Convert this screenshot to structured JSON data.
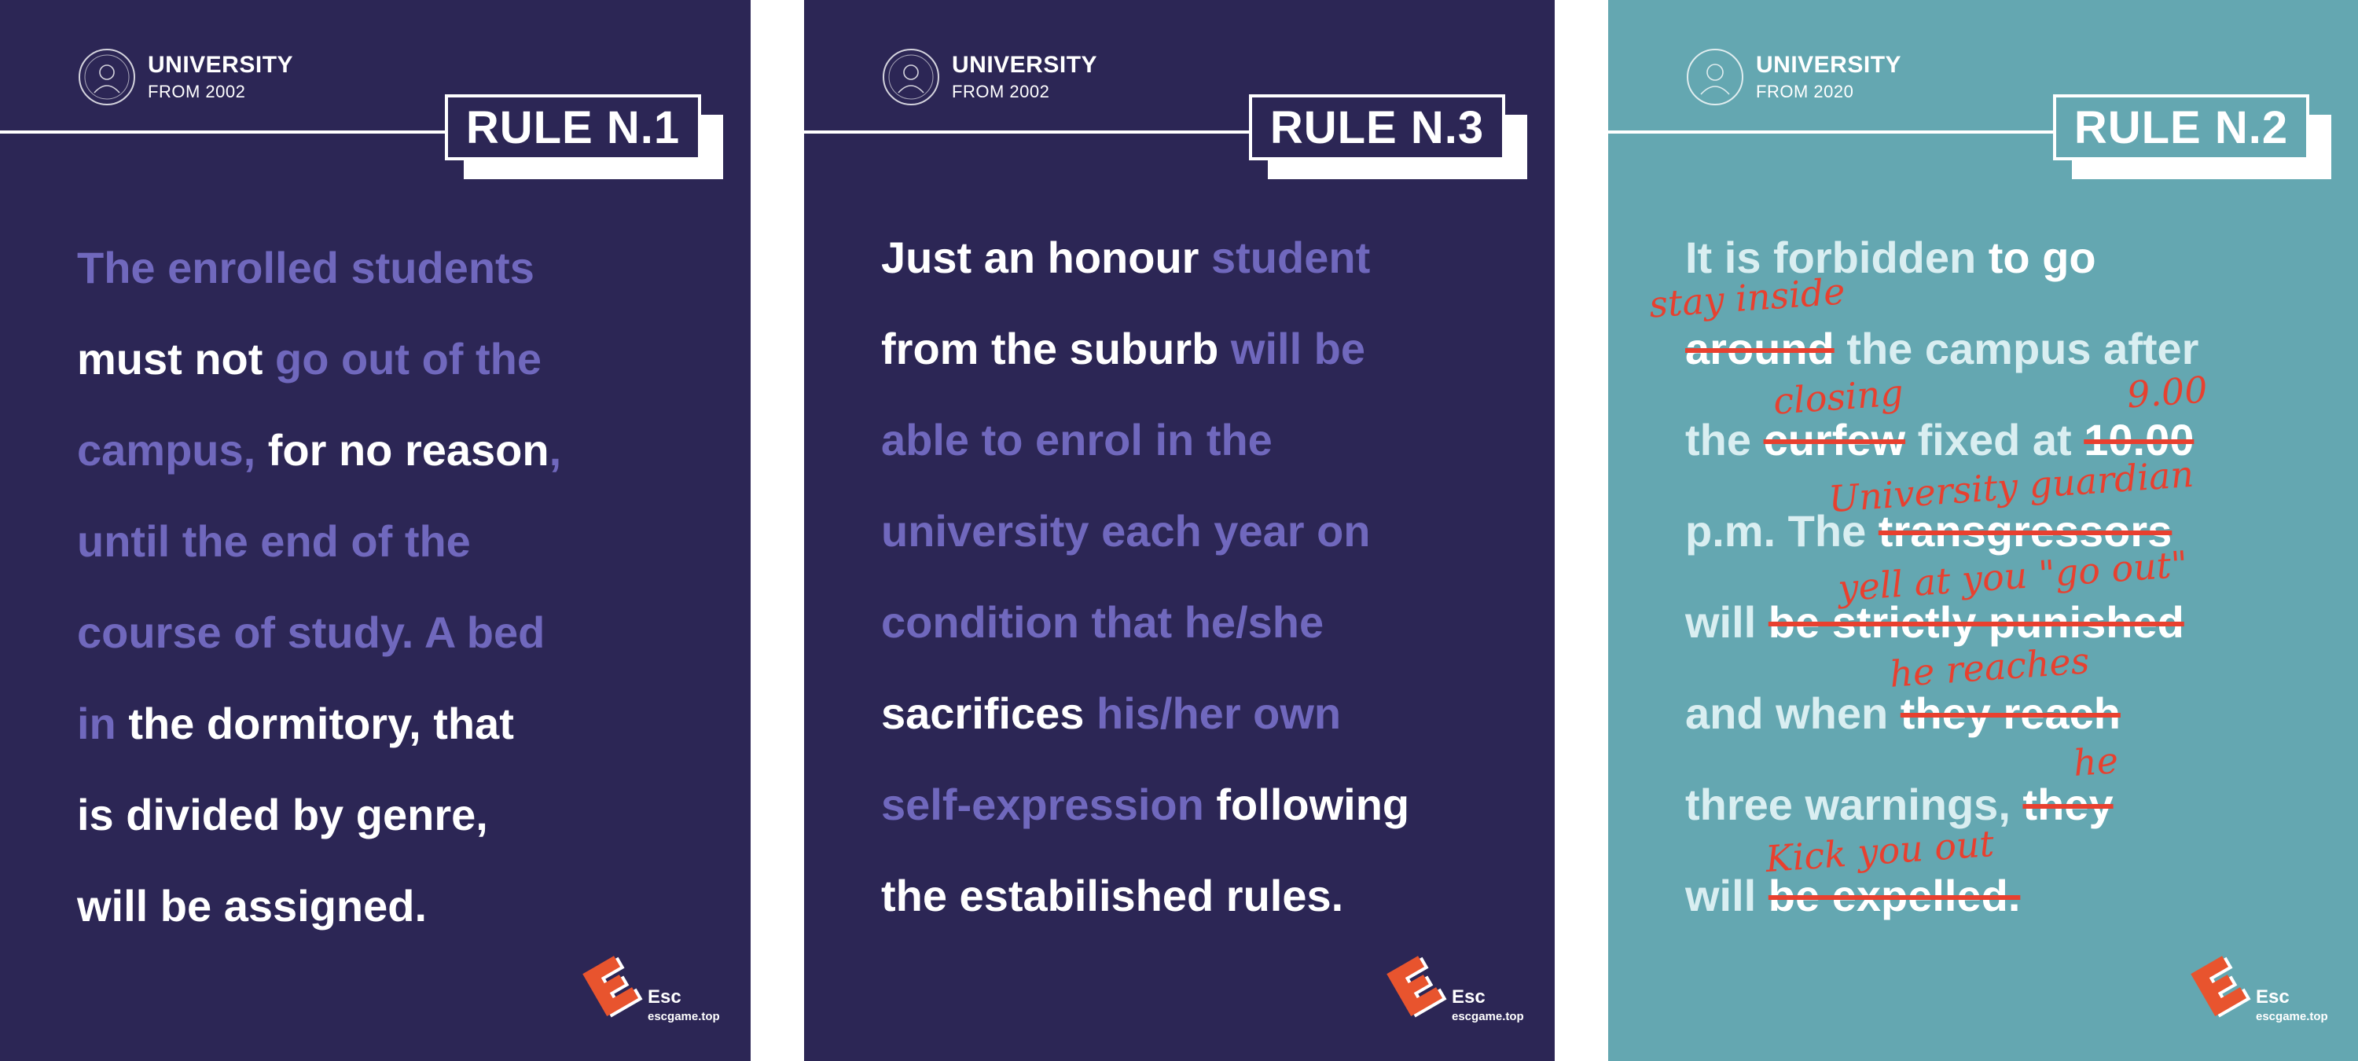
{
  "colors": {
    "navy": "#2c2655",
    "teal": "#64a7b1",
    "purple": "#7068bd",
    "white": "#ffffff",
    "correction_red": "#e8402f",
    "logo_orange": "#e8542e"
  },
  "posters": [
    {
      "university": "UNIVERSITY",
      "since": "FROM 2002",
      "rule_label": "RULE N.1",
      "text": {
        "l1a": "The enrolled students",
        "l2a": "must not",
        "l2b": " go out of the",
        "l3a": "campus,",
        "l3b": " for no reason",
        "l3c": ",",
        "l4a": "until the end of the",
        "l5a": "course of study. A bed",
        "l6a": "in",
        "l6b": " the dormitory, that",
        "l7a": "is divided by genre,",
        "l8a": "will be assigned."
      },
      "brand": "Esc",
      "site": "escgame.top"
    },
    {
      "university": "UNIVERSITY",
      "since": "FROM 2002",
      "rule_label": "RULE N.3",
      "text": {
        "l1a": "Just an honour",
        "l1b": " student",
        "l2a": "from the suburb",
        "l2b": " will be",
        "l3a": "able to enrol in the",
        "l4a": "university each year on",
        "l5a": "condition that he/she",
        "l6a": "sacrifices",
        "l6b": " his/her own",
        "l7a": "self-expression",
        "l7b": " following",
        "l8a": "the estabilished rules."
      },
      "brand": "Esc",
      "site": "escgame.top"
    },
    {
      "university": "UNIVERSITY",
      "since": "FROM 2020",
      "rule_label": "RULE N.2",
      "text": {
        "l1a": "It is forbidden",
        "l1b": " to go",
        "l2a": "around",
        "l2b": " the campus after",
        "l3a": "the ",
        "l3b": "curfew",
        "l3c": " fixed at ",
        "l3d": "10.00",
        "l4a": "p.m. The ",
        "l4b": "transgressors",
        "l5a": "will ",
        "l5b": "be strictly punished",
        "l6a": "and when ",
        "l6b": "they reach",
        "l7a": "three warnings, ",
        "l7b": "they",
        "l8a": "will ",
        "l8b": "be expelled."
      },
      "corrections": {
        "c1": "stay inside",
        "c2": "closing",
        "c3": "9.00",
        "c4": "University guardian",
        "c5": "yell at you \"go out\"",
        "c6": "he reaches",
        "c7": "he",
        "c8": "Kick you out"
      },
      "brand": "Esc",
      "site": "escgame.top"
    }
  ]
}
